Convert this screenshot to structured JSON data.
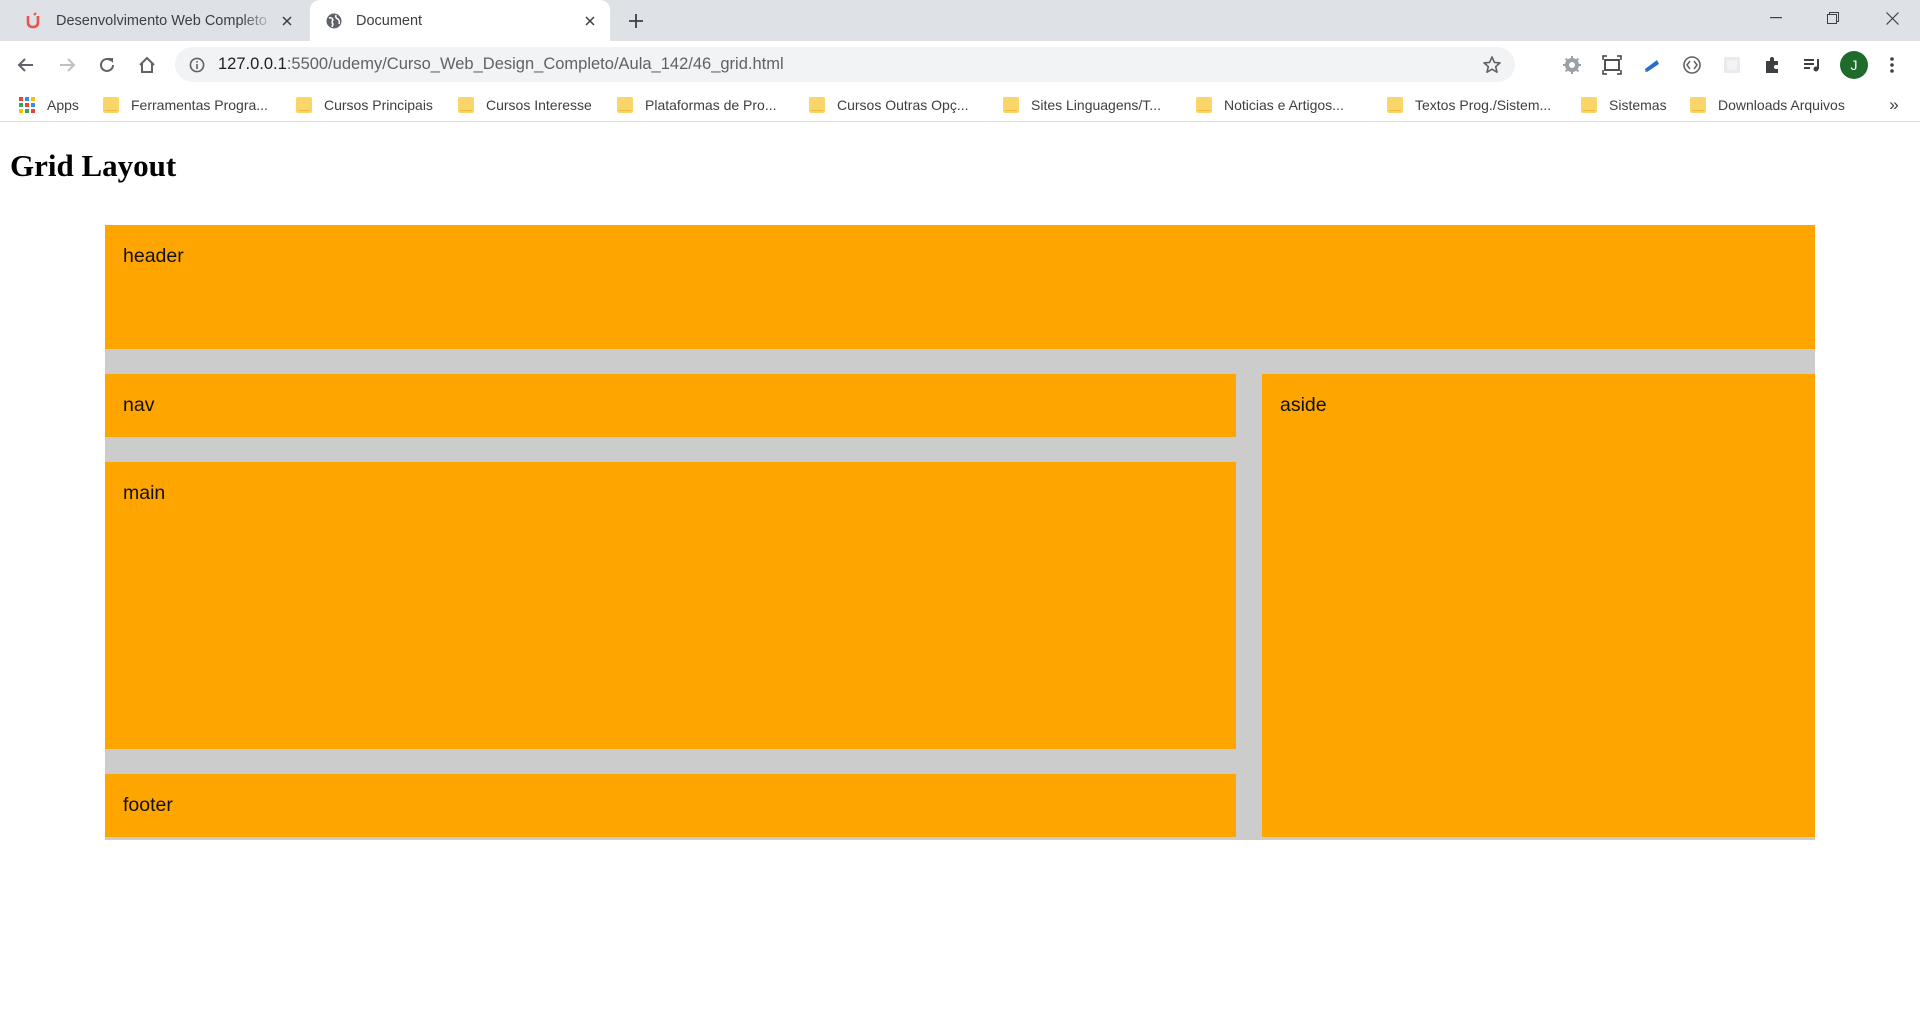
{
  "browser": {
    "tabs": [
      {
        "title": "Desenvolvimento Web Completo",
        "favicon": "udemy-icon",
        "active": false
      },
      {
        "title": "Document",
        "favicon": "globe-icon",
        "active": true
      }
    ],
    "address_bar": {
      "host": "127.0.0.1",
      "path": ":5500/udemy/Curso_Web_Design_Completo/Aula_142/46_grid.html"
    },
    "profile_initial": "J",
    "bookmarks": [
      {
        "label": "Apps",
        "icon": "apps-grid-icon"
      },
      {
        "label": "Ferramentas Progra...",
        "icon": "folder-icon"
      },
      {
        "label": "Cursos Principais",
        "icon": "folder-icon"
      },
      {
        "label": "Cursos Interesse",
        "icon": "folder-icon"
      },
      {
        "label": "Plataformas de Pro...",
        "icon": "folder-icon"
      },
      {
        "label": "Cursos Outras Opç...",
        "icon": "folder-icon"
      },
      {
        "label": "Sites Linguagens/T...",
        "icon": "folder-icon"
      },
      {
        "label": "Noticias e Artigos...",
        "icon": "folder-icon"
      },
      {
        "label": "Textos Prog./Sistem...",
        "icon": "folder-icon"
      },
      {
        "label": "Sistemas",
        "icon": "folder-icon"
      },
      {
        "label": "Downloads Arquivos",
        "icon": "folder-icon"
      }
    ],
    "bookmarks_overflow": "»"
  },
  "page": {
    "heading": "Grid Layout",
    "grid": {
      "header": "header",
      "nav": "nav",
      "main": "main",
      "aside": "aside",
      "footer": "footer"
    }
  },
  "colors": {
    "grid_cell": "#ffa500",
    "grid_gap": "#cccccc",
    "tab_strip": "#dee1e6",
    "avatar": "#1e6b2c"
  }
}
